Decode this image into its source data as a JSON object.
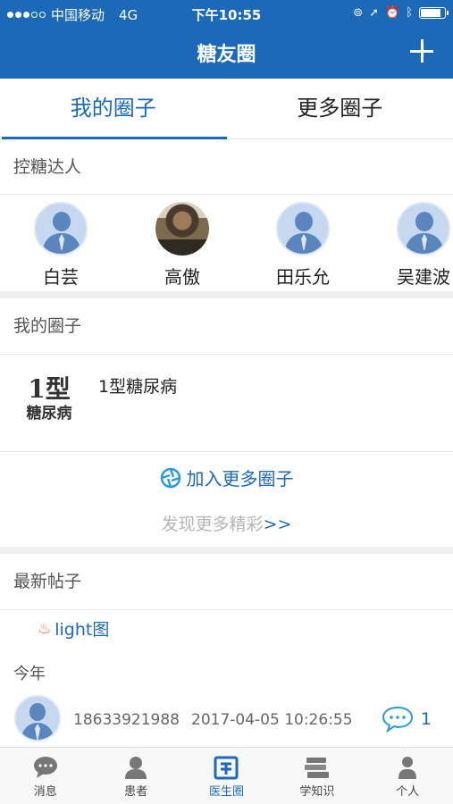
{
  "status_bar": {
    "carrier": "中国移动",
    "network": "4G",
    "time": "下午10:55"
  },
  "nav": {
    "title": "糖友圈"
  },
  "tabs": [
    {
      "label": "我的圈子",
      "active": true
    },
    {
      "label": "更多圈子",
      "active": false
    }
  ],
  "experts_section": {
    "title": "控糖达人",
    "people": [
      {
        "name": "白芸",
        "avatar": "default-user-icon"
      },
      {
        "name": "高傲",
        "avatar": "photo"
      },
      {
        "name": "田乐允",
        "avatar": "default-user-icon"
      },
      {
        "name": "吴建波",
        "avatar": "default-user-icon"
      }
    ]
  },
  "my_circles": {
    "title": "我的圈子",
    "items": [
      {
        "logo_line1": "1型",
        "logo_line2": "糖尿病",
        "name": "1型糖尿病"
      }
    ],
    "join_label": "加入更多圈子",
    "discover_label": "发现更多精彩",
    "discover_arrows": ">>"
  },
  "latest_posts": {
    "title": "最新帖子",
    "tag": "light图",
    "year_label": "今年",
    "posts": [
      {
        "user": "18633921988",
        "time": "2017-04-05 10:26:55",
        "comments": "1"
      }
    ]
  },
  "tabbar": [
    {
      "label": "消息",
      "icon": "chat-icon",
      "active": false
    },
    {
      "label": "患者",
      "icon": "patient-icon",
      "active": false
    },
    {
      "label": "医生圈",
      "icon": "doctor-circle-icon",
      "active": true
    },
    {
      "label": "学知识",
      "icon": "books-icon",
      "active": false
    },
    {
      "label": "个人",
      "icon": "person-icon",
      "active": false
    }
  ],
  "colors": {
    "primary": "#1c6ab7",
    "flame": "#ff6b3d",
    "bg_gap": "#f0f0f0"
  }
}
